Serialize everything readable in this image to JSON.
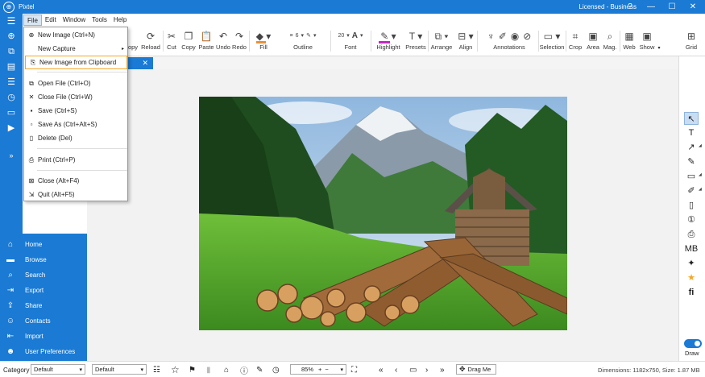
{
  "app": {
    "title": "Pixtel",
    "license": "Licensed - Business"
  },
  "window_controls": {
    "help": "?",
    "minimize": "—",
    "maximize": "☐",
    "close": "✕"
  },
  "menubar": {
    "items": [
      "File",
      "Edit",
      "Window",
      "Tools",
      "Help"
    ]
  },
  "file_menu": {
    "items": [
      {
        "label": "New Image (Ctrl+N)",
        "icon": "plus-circle-icon"
      },
      {
        "label": "New Capture",
        "icon": "",
        "submenu": true
      },
      {
        "label": "New Image from Clipboard",
        "icon": "clipboard-icon",
        "highlighted": true
      },
      {
        "label": "Open File (Ctrl+O)",
        "icon": "folder-open-icon"
      },
      {
        "label": "Close File (Ctrl+W)",
        "icon": "close-icon"
      },
      {
        "label": "Save (Ctrl+S)",
        "icon": "save-icon"
      },
      {
        "label": "Save As (Ctrl+Alt+S)",
        "icon": "save-as-icon"
      },
      {
        "label": "Delete (Del)",
        "icon": "trash-icon"
      },
      {
        "label": "Print (Ctrl+P)",
        "icon": "printer-icon"
      },
      {
        "label": "Close (Alt+F4)",
        "icon": "close-window-icon"
      },
      {
        "label": "Quit (Alt+F5)",
        "icon": "quit-icon"
      }
    ]
  },
  "toolbar": {
    "copy_partial": "opy",
    "reload": "Reload",
    "cut": "Cut",
    "copy": "Copy",
    "paste": "Paste",
    "undo": "Undo",
    "redo": "Redo",
    "fill": "Fill",
    "outline": "Outline",
    "outline_width": "6",
    "font": "Font",
    "font_size": "20",
    "highlight": "Highlight",
    "presets": "Presets",
    "arrange": "Arrange",
    "align": "Align",
    "annotations": "Annotations",
    "selection": "Selection",
    "crop": "Crop",
    "area": "Area",
    "mag": "Mag.",
    "web": "Web",
    "show": "Show",
    "grid": "Grid"
  },
  "tab": {
    "close": "✕"
  },
  "nav": {
    "items": [
      "Home",
      "Browse",
      "Search",
      "Export",
      "Share",
      "Contacts",
      "Import",
      "User Preferences"
    ]
  },
  "right_panel": {
    "draw_label": "Draw"
  },
  "statusbar": {
    "category_label": "Category",
    "category_value": "Default",
    "second_value": "Default",
    "zoom": "85%",
    "drag_me": "Drag Me",
    "dimensions": "Dimensions: 1182x750, Size: 1.87 MB"
  },
  "colors": {
    "accent": "#1a7ad4",
    "fill_swatch": "#e69138",
    "highlight_swatch": "#c227c2",
    "menu_highlight": "#f5a623"
  }
}
